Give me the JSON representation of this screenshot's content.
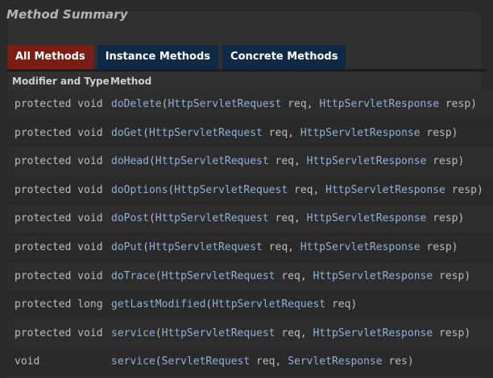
{
  "section_title": "Method Summary",
  "tabs": [
    {
      "label": "All Methods",
      "active": true
    },
    {
      "label": "Instance Methods",
      "active": false
    },
    {
      "label": "Concrete Methods",
      "active": false
    }
  ],
  "columns": {
    "modifier": "Modifier and Type",
    "method": "Method"
  },
  "rows": [
    {
      "modifier": "protected void",
      "name": "doDelete",
      "p1type": "HttpServletRequest",
      "p1name": " req, ",
      "p2type": "HttpServletResponse",
      "p2name": " resp)",
      "highlighted": false
    },
    {
      "modifier": "protected void",
      "name": "doGet",
      "p1type": "HttpServletRequest",
      "p1name": " req, ",
      "p2type": "HttpServletResponse",
      "p2name": " resp)",
      "highlighted": true
    },
    {
      "modifier": "protected void",
      "name": "doHead",
      "p1type": "HttpServletRequest",
      "p1name": " req, ",
      "p2type": "HttpServletResponse",
      "p2name": " resp)",
      "highlighted": false
    },
    {
      "modifier": "protected void",
      "name": "doOptions",
      "p1type": "HttpServletRequest",
      "p1name": " req, ",
      "p2type": "HttpServletResponse",
      "p2name": " resp)",
      "highlighted": false
    },
    {
      "modifier": "protected void",
      "name": "doPost",
      "p1type": "HttpServletRequest",
      "p1name": " req, ",
      "p2type": "HttpServletResponse",
      "p2name": " resp)",
      "highlighted": true
    },
    {
      "modifier": "protected void",
      "name": "doPut",
      "p1type": "HttpServletRequest",
      "p1name": " req, ",
      "p2type": "HttpServletResponse",
      "p2name": " resp)",
      "highlighted": false
    },
    {
      "modifier": "protected void",
      "name": "doTrace",
      "p1type": "HttpServletRequest",
      "p1name": " req, ",
      "p2type": "HttpServletResponse",
      "p2name": " resp)",
      "highlighted": false
    },
    {
      "modifier": "protected long",
      "name": "getLastModified",
      "p1type": "HttpServletRequest",
      "p1name": " req)",
      "p2type": "",
      "p2name": "",
      "highlighted": false
    },
    {
      "modifier": "protected void",
      "name": "service",
      "p1type": "HttpServletRequest",
      "p1name": " req, ",
      "p2type": "HttpServletResponse",
      "p2name": " resp)",
      "highlighted": false
    },
    {
      "modifier": "void",
      "name": "service",
      "p1type": "ServletRequest",
      "p1name": " req, ",
      "p2type": "ServletResponse",
      "p2name": " res)",
      "highlighted": false
    }
  ],
  "colors": {
    "active_tab": "#7a1d12",
    "inactive_tab": "#0f2a44",
    "link": "#8fb2d9",
    "highlight_underline": "#c81e1e",
    "background": "#2b2b2b"
  }
}
